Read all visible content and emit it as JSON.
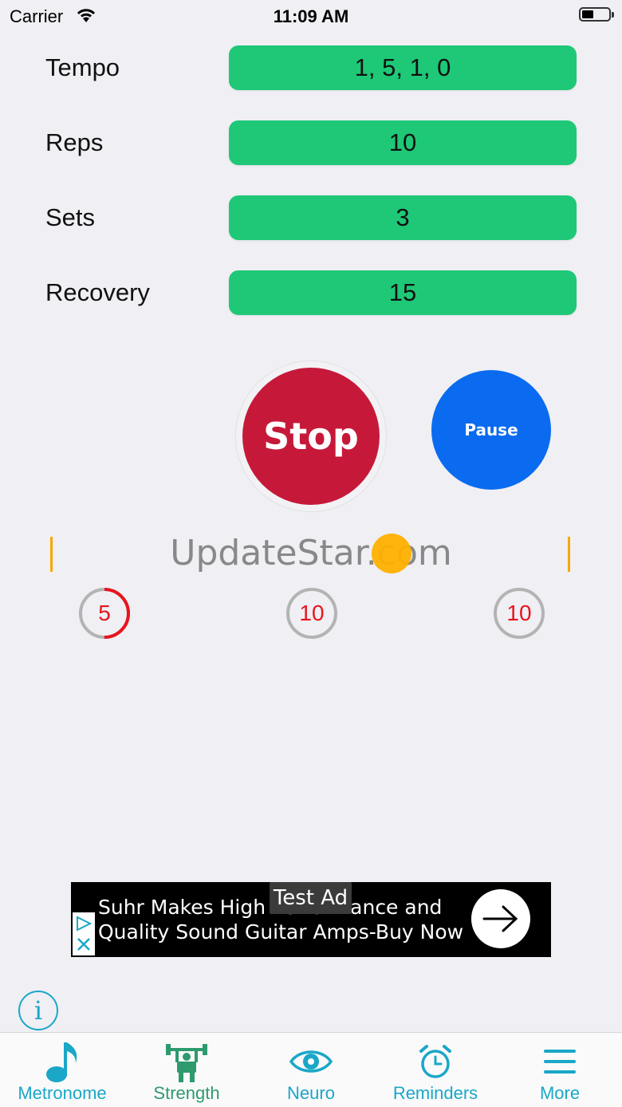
{
  "status_bar": {
    "carrier": "Carrier",
    "time": "11:09 AM"
  },
  "settings": [
    {
      "label": "Tempo",
      "value": "1, 5, 1, 0"
    },
    {
      "label": "Reps",
      "value": "10"
    },
    {
      "label": "Sets",
      "value": "3"
    },
    {
      "label": "Recovery",
      "value": "15"
    }
  ],
  "buttons": {
    "stop": "Stop",
    "pause": "Pause"
  },
  "watermark": "UpdateStar.com",
  "counters": [
    {
      "value": "5",
      "progress": 0.5
    },
    {
      "value": "10",
      "progress": 0
    },
    {
      "value": "10",
      "progress": 0
    }
  ],
  "ad": {
    "line1": "Suhr Makes High Performance and",
    "line2": "Quality Sound Guitar Amps-Buy Now",
    "tag": "Test Ad"
  },
  "info_icon": "i",
  "tabs": [
    {
      "label": "Metronome",
      "icon": "music-note-icon"
    },
    {
      "label": "Strength",
      "icon": "weightlifter-icon"
    },
    {
      "label": "Neuro",
      "icon": "eye-icon"
    },
    {
      "label": "Reminders",
      "icon": "alarm-clock-icon"
    },
    {
      "label": "More",
      "icon": "menu-icon"
    }
  ],
  "colors": {
    "accent_green": "#1ec877",
    "stop_red": "#c6193a",
    "pause_blue": "#0a6bf0",
    "tab_teal": "#1aa7c8",
    "counter_red": "#e8141c",
    "marker_orange": "#f5a800"
  }
}
